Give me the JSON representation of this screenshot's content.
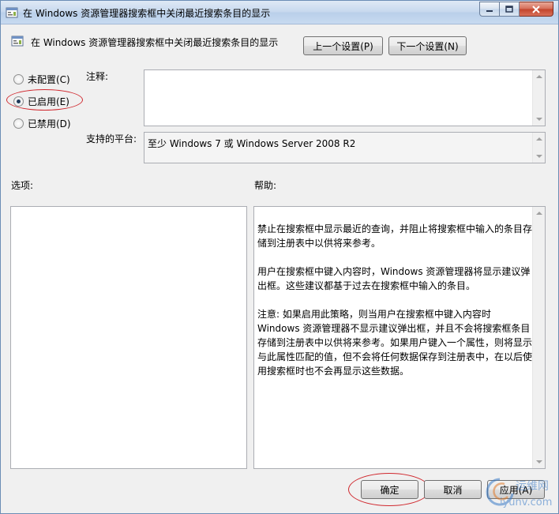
{
  "window": {
    "title": "在 Windows 资源管理器搜索框中关闭最近搜索条目的显示",
    "caption_buttons": [
      "minimize",
      "maximize",
      "close"
    ]
  },
  "header": {
    "setting_title": "在 Windows 资源管理器搜索框中关闭最近搜索条目的显示",
    "prev_button": "上一个设置(P)",
    "next_button": "下一个设置(N)"
  },
  "state": {
    "options": [
      {
        "label": "未配置(C)",
        "checked": false
      },
      {
        "label": "已启用(E)",
        "checked": true
      },
      {
        "label": "已禁用(D)",
        "checked": false
      }
    ]
  },
  "comment": {
    "label": "注释:",
    "value": ""
  },
  "platform": {
    "label": "支持的平台:",
    "value": "至少 Windows 7 或 Windows Server 2008 R2"
  },
  "options_section": {
    "label": "选项:"
  },
  "help_section": {
    "label": "帮助:",
    "paragraphs": [
      "禁止在搜索框中显示最近的查询，并阻止将搜索框中输入的条目存储到注册表中以供将来参考。",
      "用户在搜索框中键入内容时，Windows 资源管理器将显示建议弹出框。这些建议都基于过去在搜索框中输入的条目。",
      "注意: 如果启用此策略，则当用户在搜索框中键入内容时 Windows 资源管理器不显示建议弹出框，并且不会将搜索框条目存储到注册表中以供将来参考。如果用户键入一个属性，则将显示与此属性匹配的值，但不会将任何数据保存到注册表中，在以后使用搜索框时也不会再显示这些数据。"
    ]
  },
  "footer": {
    "ok_button": "确定",
    "cancel_button": "取消",
    "apply_button": "应用(A)"
  },
  "watermark": {
    "text": "运维网",
    "subtext": "iyunv.com"
  },
  "colors": {
    "annotation_ellipse": "#d0282e",
    "title_bar": "#c6d8ee"
  }
}
